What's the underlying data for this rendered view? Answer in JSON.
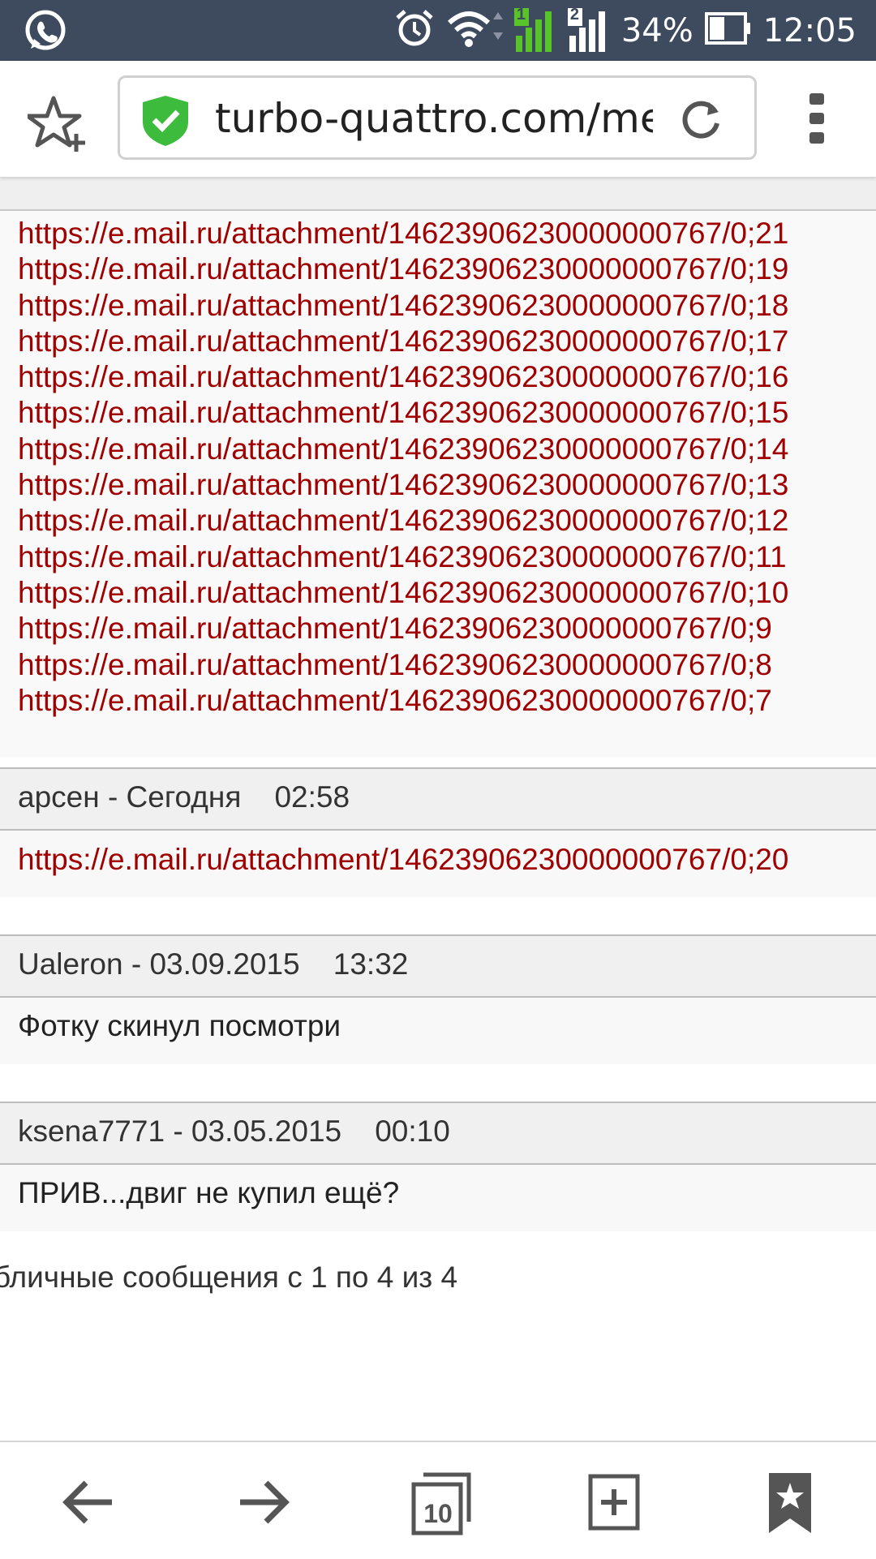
{
  "status_bar": {
    "battery_percent": "34%",
    "time": "12:05",
    "sim1_label": "1",
    "sim2_label": "2",
    "icons": [
      "whatsapp-icon",
      "alarm-icon",
      "wifi-icon",
      "signal-sim1-icon",
      "signal-sim2-icon",
      "battery-icon"
    ]
  },
  "browser": {
    "url": "turbo-quattro.com/mer",
    "icons": [
      "bookmark-add-icon",
      "secure-shield-icon",
      "reload-icon",
      "overflow-menu-icon"
    ]
  },
  "thread": {
    "top_links": [
      "https://e.mail.ru/attachment/14623906230000000767/0;21",
      "https://e.mail.ru/attachment/14623906230000000767/0;19",
      "https://e.mail.ru/attachment/14623906230000000767/0;18",
      "https://e.mail.ru/attachment/14623906230000000767/0;17",
      "https://e.mail.ru/attachment/14623906230000000767/0;16",
      "https://e.mail.ru/attachment/14623906230000000767/0;15",
      "https://e.mail.ru/attachment/14623906230000000767/0;14",
      "https://e.mail.ru/attachment/14623906230000000767/0;13",
      "https://e.mail.ru/attachment/14623906230000000767/0;12",
      "https://e.mail.ru/attachment/14623906230000000767/0;11",
      "https://e.mail.ru/attachment/14623906230000000767/0;10",
      "https://e.mail.ru/attachment/14623906230000000767/0;9",
      "https://e.mail.ru/attachment/14623906230000000767/0;8",
      "https://e.mail.ru/attachment/14623906230000000767/0;7"
    ],
    "posts": [
      {
        "author_line": "арсен - Сегодня    02:58",
        "link": "https://e.mail.ru/attachment/14623906230000000767/0;20"
      },
      {
        "author_line": "Ualeron - 03.09.2015    13:32",
        "text": "Фотку скинул посмотри"
      },
      {
        "author_line": "ksena7771 - 03.05.2015    00:10",
        "text": "ПРИВ...двиг не купил ещё?"
      }
    ],
    "footer": "бличные сообщения с 1 по 4 из 4"
  },
  "bottom_nav": {
    "tabs_count": "10",
    "icons": [
      "back-arrow-icon",
      "forward-arrow-icon",
      "tabs-icon",
      "new-tab-icon",
      "bookmarks-icon"
    ]
  },
  "colors": {
    "status_bar": "#3e4a5e",
    "link": "#a00000",
    "shield": "#3dbb3d",
    "signal_green": "#59c32a"
  }
}
